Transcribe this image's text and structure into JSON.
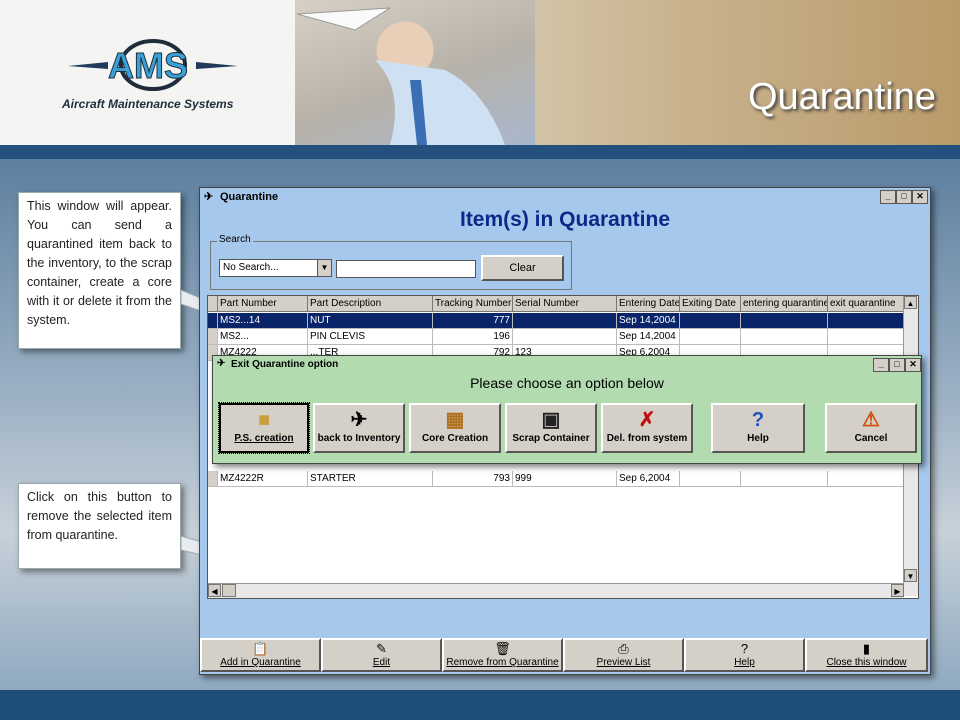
{
  "slide": {
    "title": "Quarantine"
  },
  "logo": {
    "text": "AMS",
    "subtitle": "Aircraft Maintenance Systems"
  },
  "callouts": {
    "top": "This window will appear. You can send a quarantined item back to the inventory, to the scrap container, create a core with it or delete it from the system.",
    "bottom": "Click on this button to remove the selected item from quarantine."
  },
  "window": {
    "title": "Quarantine",
    "heading": "Item(s) in Quarantine",
    "search": {
      "label": "Search",
      "select_value": "No Search...",
      "input_value": "",
      "clear_label": "Clear"
    },
    "columns": [
      "Part Number",
      "Part Description",
      "Tracking Number",
      "Serial Number",
      "Entering Date",
      "Exiting Date",
      "entering quarantine",
      "exit quarantine"
    ],
    "rows": [
      {
        "part": "MS2...14",
        "desc": "NUT",
        "tracking": "777",
        "serial": "",
        "entering": "Sep 14,2004"
      },
      {
        "part": "MS2...",
        "desc": "PIN CLEVIS",
        "tracking": "196",
        "serial": "",
        "entering": "Sep 14,2004"
      },
      {
        "part": "MZ4222",
        "desc": "...TER",
        "tracking": "792",
        "serial": "123",
        "entering": "Sep 6,2004"
      },
      {
        "part": "MZ4222R",
        "desc": "STARTER",
        "tracking": "793",
        "serial": "999",
        "entering": "Sep 6,2004"
      }
    ],
    "bottom_buttons": [
      {
        "label": "Add in Quarantine",
        "icon": "add-icon"
      },
      {
        "label": "Edit",
        "icon": "edit-icon"
      },
      {
        "label": "Remove from Quarantine",
        "icon": "trash-icon"
      },
      {
        "label": "Preview List",
        "icon": "printer-icon"
      },
      {
        "label": "Help",
        "icon": "help-icon"
      },
      {
        "label": "Close this window",
        "icon": "door-icon"
      }
    ]
  },
  "dialog": {
    "title": "Exit Quarantine option",
    "heading": "Please choose an option below",
    "options": [
      {
        "label": "P.S. creation",
        "icon": "box-icon"
      },
      {
        "label": "back to Inventory",
        "icon": "inventory-icon"
      },
      {
        "label": "Core Creation",
        "icon": "crate-icon"
      },
      {
        "label": "Scrap Container",
        "icon": "container-icon"
      },
      {
        "label": "Del. from system",
        "icon": "delete-icon"
      },
      {
        "label": "Help",
        "icon": "help-icon"
      },
      {
        "label": "Cancel",
        "icon": "cancel-icon"
      }
    ]
  },
  "colors": {
    "header_band": "#23507c",
    "window_bg": "#a6c8ec",
    "dialog_bg": "#b2dbb0",
    "heading": "#0a2a8a",
    "selected_row": "#0a246a"
  }
}
